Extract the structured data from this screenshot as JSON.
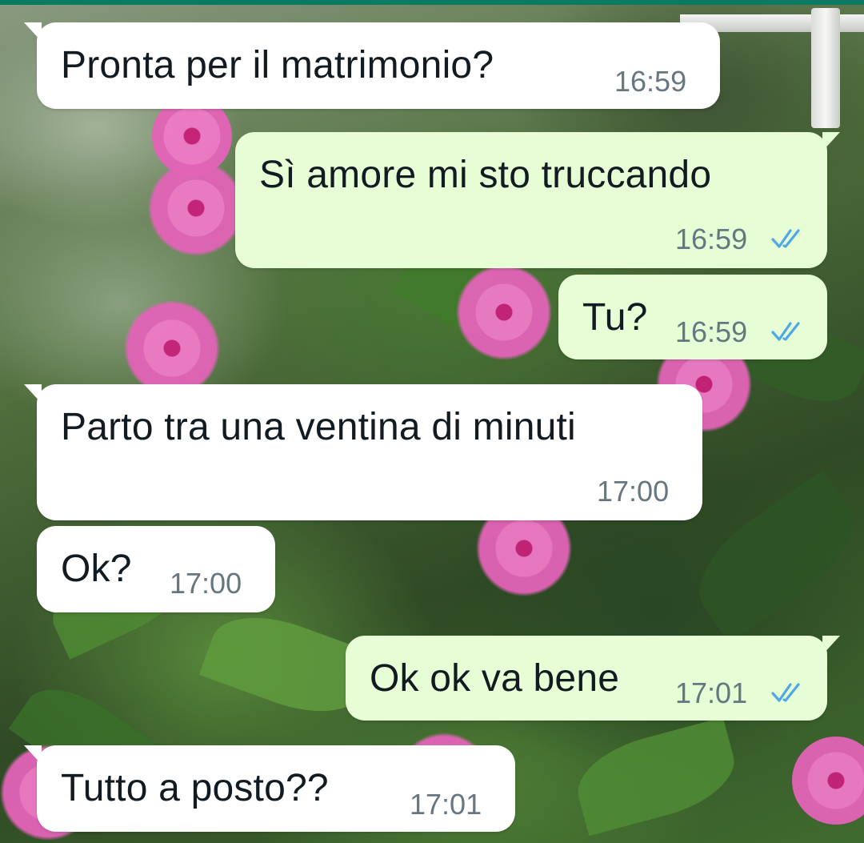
{
  "colors": {
    "incoming_bubble": "#ffffff",
    "outgoing_bubble": "#e7fdd5",
    "time_text": "#667781",
    "read_ticks": "#4fa8e6",
    "top_strip": "#0b7a62"
  },
  "messages": [
    {
      "direction": "incoming",
      "text": "Pronta per il matrimonio?",
      "time": "16:59"
    },
    {
      "direction": "outgoing",
      "text": "Sì amore mi sto truccando",
      "time": "16:59",
      "status": "read-double-check-icon"
    },
    {
      "direction": "outgoing",
      "text": "Tu?",
      "time": "16:59",
      "status": "read-double-check-icon"
    },
    {
      "direction": "incoming",
      "text": "Parto tra una ventina di minuti",
      "time": "17:00"
    },
    {
      "direction": "incoming",
      "text": "Ok?",
      "time": "17:00"
    },
    {
      "direction": "outgoing",
      "text": "Ok ok va bene",
      "time": "17:01",
      "status": "read-double-check-icon"
    },
    {
      "direction": "incoming",
      "text": "Tutto a posto??",
      "time": "17:01"
    }
  ]
}
